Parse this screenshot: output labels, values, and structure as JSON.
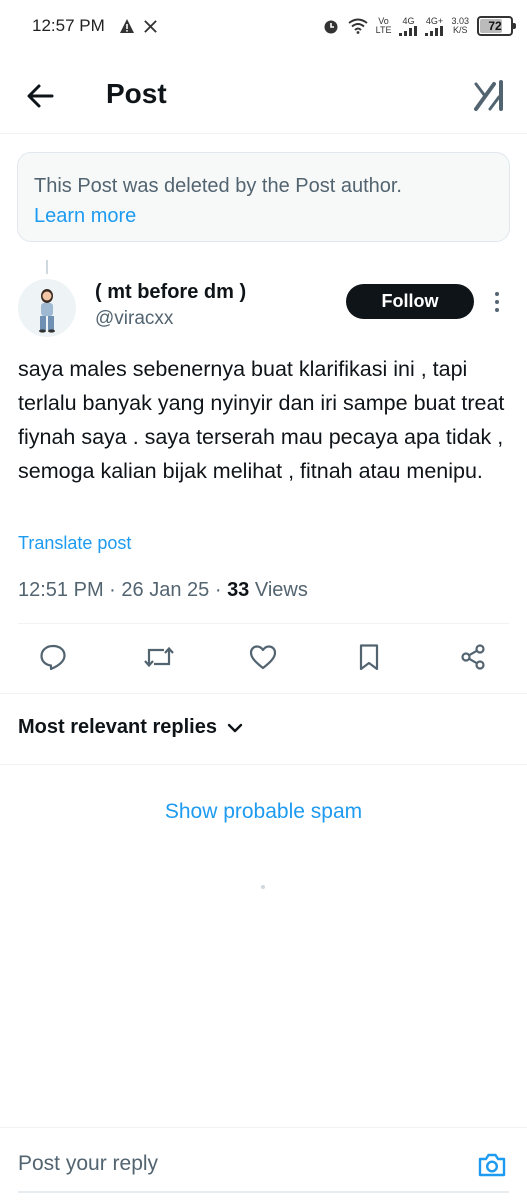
{
  "status_bar": {
    "time": "12:57 PM",
    "network_vo": "Vo",
    "network_lte": "LTE",
    "signal1": "4G",
    "signal2": "4G+",
    "speed": "3.03",
    "speed_unit": "K/S",
    "battery": "72",
    "icons": [
      "alert-icon",
      "x-logo-icon",
      "alarm-icon",
      "wifi-icon",
      "signal-icon",
      "battery-icon"
    ]
  },
  "header": {
    "title": "Post",
    "back_icon": "back-arrow-icon",
    "grok_icon": "grok-icon"
  },
  "deleted_notice": {
    "text": "This Post was deleted by the Post author.",
    "link": "Learn more"
  },
  "post": {
    "author_name": "( mt before dm )",
    "author_handle": "@viracxx",
    "follow_label": "Follow",
    "text": "saya males sebenernya buat klarifikasi ini , tapi terlalu banyak yang nyinyir dan iri sampe buat treat fiynah saya . saya terserah mau pecaya apa tidak , semoga kalian bijak melihat , fitnah atau menipu.",
    "translate_label": "Translate post",
    "time": "12:51 PM",
    "separator": "·",
    "date": "26 Jan 25",
    "views_count": "33",
    "views_label": "Views"
  },
  "actions": [
    "reply-icon",
    "repost-icon",
    "like-icon",
    "bookmark-icon",
    "share-icon"
  ],
  "replies": {
    "sort_label": "Most relevant replies",
    "spam_label": "Show probable spam"
  },
  "reply_bar": {
    "placeholder": "Post your reply"
  },
  "colors": {
    "accent": "#1d9bf0",
    "text": "#0f1419",
    "muted": "#536471",
    "notice_bg": "#f7f9f9"
  }
}
